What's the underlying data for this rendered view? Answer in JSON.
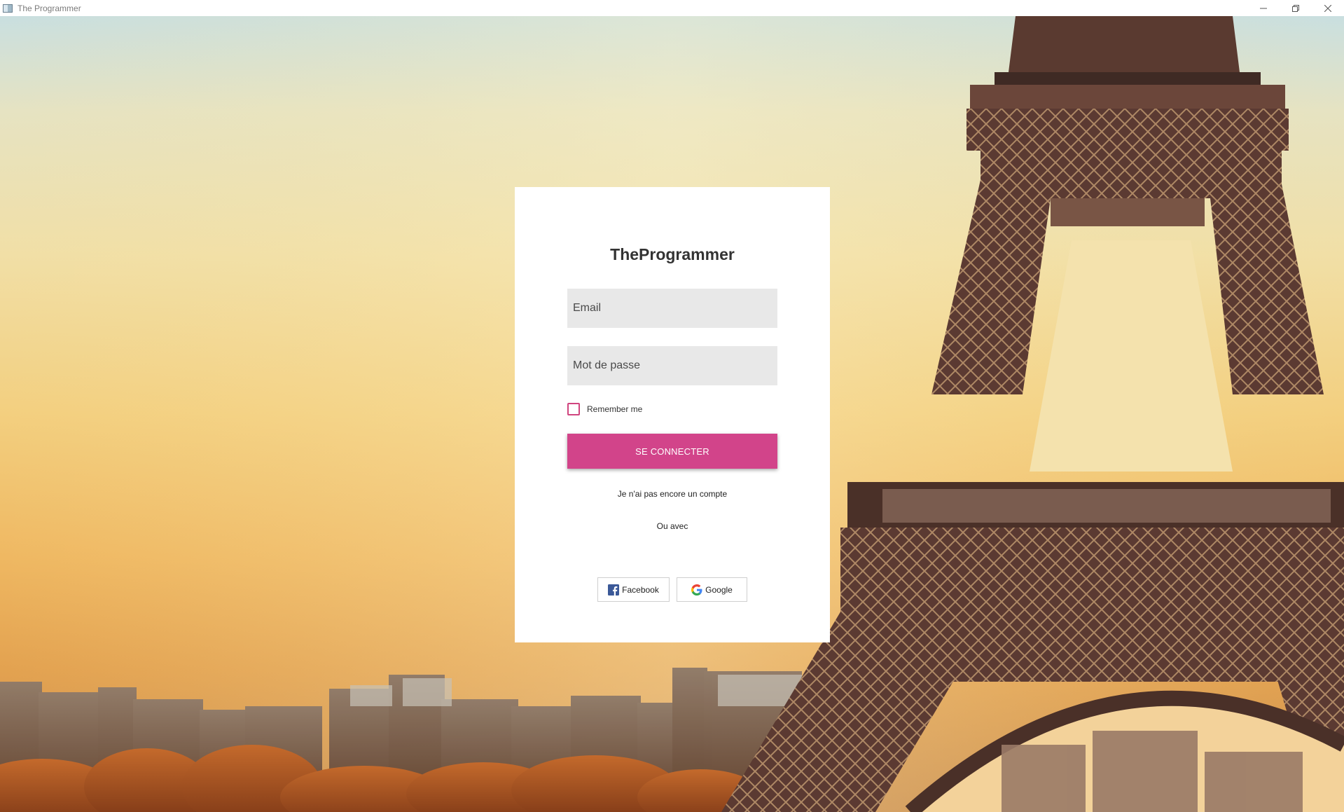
{
  "window": {
    "title": "The Programmer"
  },
  "login": {
    "brand": "TheProgrammer",
    "email_placeholder": "Email",
    "password_placeholder": "Mot de passe",
    "remember_label": "Remember me",
    "remember_checked": false,
    "submit_label": "SE CONNECTER",
    "signup_link": "Je n'ai pas encore un compte",
    "or_with": "Ou avec",
    "social": {
      "facebook_label": "Facebook",
      "google_label": "Google"
    }
  },
  "colors": {
    "accent": "#d2448a",
    "field_bg": "#e8e8e8",
    "card_bg": "#ffffff"
  },
  "icons": {
    "app": "app-window-icon",
    "minimize": "minimize-icon",
    "restore": "restore-icon",
    "close": "close-icon",
    "facebook": "facebook-icon",
    "google": "google-icon"
  }
}
